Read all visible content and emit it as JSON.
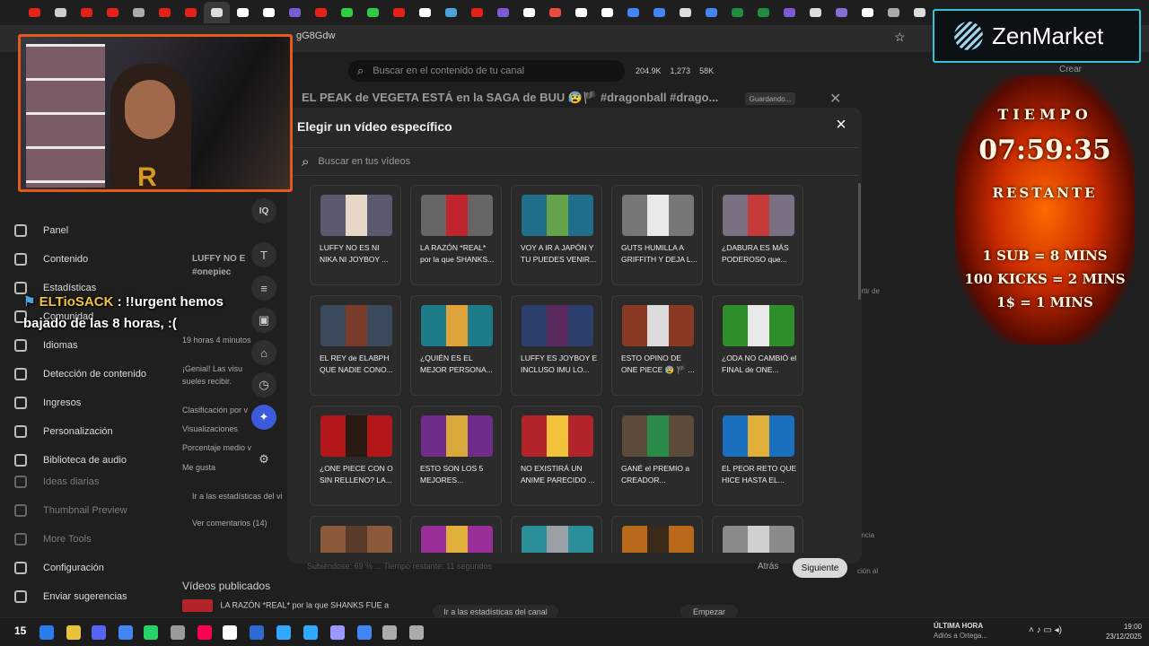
{
  "browser": {
    "url_fragment": "gG8Gdw",
    "tab_colors": [
      "#e62117",
      "#cfcfcf",
      "#e62117",
      "#e62117",
      "#aaa",
      "#e62117",
      "#e62117",
      "#ddd",
      "#fff",
      "#fff",
      "#7b5cd6",
      "#e62117",
      "#2ecc40",
      "#2ecc40",
      "#e62117",
      "#fff",
      "#4aa3df",
      "#e62117",
      "#7b5cd6",
      "#fff",
      "#e84c3d",
      "#fff",
      "#fff",
      "#4285f4",
      "#4285f4",
      "#ddd",
      "#4285f4",
      "#1e8e3e",
      "#1e8e3e",
      "#7b5cd6",
      "#ddd",
      "#8a6cd6",
      "#fff",
      "#aaa",
      "#ddd"
    ]
  },
  "studio": {
    "search_placeholder": "Buscar en el contenido de tu canal",
    "stats": {
      "a": "204.9K",
      "b": "1,273",
      "c": "58K"
    },
    "video_title": "EL PEAK de VEGETA ESTÁ en la SAGA de BUU 😰🏴 #dragonball #drago...",
    "saving": "Guardando...",
    "sidebar": [
      {
        "label": "Panel",
        "dim": false
      },
      {
        "label": "Contenido",
        "dim": false
      },
      {
        "label": "Estadísticas",
        "dim": false
      },
      {
        "label": "Comunidad",
        "dim": false
      },
      {
        "label": "Idiomas",
        "dim": false
      },
      {
        "label": "Detección de contenido",
        "dim": false
      },
      {
        "label": "Ingresos",
        "dim": false
      },
      {
        "label": "Personalización",
        "dim": false
      },
      {
        "label": "Biblioteca de audio",
        "dim": false
      },
      {
        "label": "Ideas diarias",
        "dim": true
      },
      {
        "label": "Thumbnail Preview",
        "dim": true
      },
      {
        "label": "More Tools",
        "dim": true
      },
      {
        "label": "Configuración",
        "dim": false
      },
      {
        "label": "Enviar sugerencias",
        "dim": false
      }
    ],
    "bg_left": {
      "time": "19 horas 4 minutos",
      "tip1": "¡Genial! Las visu",
      "tip2": "sueles recibir.",
      "clas": "Clasificación por v",
      "views": "Visualizaciones",
      "avg": "Porcentaje medio v",
      "likes": "Me gusta",
      "goto_stats": "Ir a las estadísticas del vi",
      "comments": "Ver comentarios (14)"
    },
    "bg_card": {
      "title": "LUFFY NO E",
      "tag": "#onepiec"
    },
    "published_title": "Vídeos publicados",
    "published_row": "LA RAZÓN *REAL* por la que SHANKS FUE a ...",
    "goto_channel_stats": "Ir a las estadísticas del canal",
    "start": "Empezar",
    "create": "Crear",
    "right_notes": {
      "a": "artir de",
      "b": "encia",
      "c": "ción al"
    }
  },
  "modal": {
    "title": "Elegir un vídeo específico",
    "search_placeholder": "Buscar en tus vídeos",
    "upload_status": "Subiéndose: 69 % ... Tiempo restante: 11 segundos",
    "back": "Atrás",
    "next": "Siguiente",
    "videos": [
      {
        "t1": "LUFFY NO ES NI",
        "t2": "NIKA NI JOYBOY ...",
        "color": "#5b5870",
        "accent": "#e7d7c6"
      },
      {
        "t1": "LA RAZÓN *REAL*",
        "t2": "por la que SHANKS...",
        "color": "#666",
        "accent": "#c0242c"
      },
      {
        "t1": "VOY A IR A JAPÓN Y",
        "t2": "TU PUEDES VENIR...",
        "color": "#1f6f8b",
        "accent": "#66a24a"
      },
      {
        "t1": "GUTS HUMILLA A",
        "t2": "GRIFFITH Y DEJA L...",
        "color": "#777",
        "accent": "#e9e9e9"
      },
      {
        "t1": "¿DABURA ES MÁS",
        "t2": "PODEROSO que...",
        "color": "#7b6f82",
        "accent": "#c73a3a"
      },
      {
        "t1": "EL REY de ELABPH",
        "t2": "QUE NADIE CONO...",
        "color": "#3a4a5c",
        "accent": "#7b3b2a"
      },
      {
        "t1": "¿QUIÉN ES EL",
        "t2": "MEJOR PERSONA...",
        "color": "#1e7b8a",
        "accent": "#e0a33b"
      },
      {
        "t1": "LUFFY ES JOYBOY E",
        "t2": "INCLUSO IMU LO...",
        "color": "#2c3e6c",
        "accent": "#5a2a5e"
      },
      {
        "t1": "ESTO OPINO DE",
        "t2": "ONE PIECE 😰 🏴 ...",
        "color": "#8a3a22",
        "accent": "#dcdcdc"
      },
      {
        "t1": "¿ODA NO CAMBIÓ el",
        "t2": "FINAL de ONE...",
        "color": "#2e8f2a",
        "accent": "#e8e8e8"
      },
      {
        "t1": "¿ONE PIECE CON O",
        "t2": "SIN RELLENO? LA...",
        "color": "#b3171a",
        "accent": "#2a1a14"
      },
      {
        "t1": "ESTO SON LOS 5",
        "t2": "MEJORES...",
        "color": "#6f2c8a",
        "accent": "#d9a83a"
      },
      {
        "t1": "NO EXISTIRÁ UN",
        "t2": "ANIME PARECIDO ...",
        "color": "#b3232a",
        "accent": "#f2c23d"
      },
      {
        "t1": "GANÉ el PREMIO a",
        "t2": "CREADOR...",
        "color": "#5c4a3a",
        "accent": "#2a8a4a"
      },
      {
        "t1": "EL PEOR RETO QUE",
        "t2": "HICE HASTA EL...",
        "color": "#1a6fbf",
        "accent": "#e0b03b"
      },
      {
        "t1": "",
        "t2": "",
        "color": "#8a5a3a",
        "accent": "#5a3a2a"
      },
      {
        "t1": "",
        "t2": "",
        "color": "#9a2f9a",
        "accent": "#e0b03b"
      },
      {
        "t1": "",
        "t2": "",
        "color": "#2b8f9a",
        "accent": "#9aa0a6"
      },
      {
        "t1": "",
        "t2": "",
        "color": "#b86a1a",
        "accent": "#3a2a1a"
      },
      {
        "t1": "",
        "t2": "",
        "color": "#8a8a8a",
        "accent": "#d0d0d0"
      }
    ]
  },
  "overlay": {
    "chat_user": "ELTioSACK",
    "chat_message": ": !!urgent hemos bajado de las 8 horas, :(",
    "zen_name": "ZenMarket",
    "timer_label": "TIEMPO",
    "timer_value": "07:59:35",
    "timer_sub": "RESTANTE",
    "rule1": "1 SUB = 8 MINS",
    "rule2": "100 KICKS = 2 MINS",
    "rule3": "1$ = 1 MINS"
  },
  "taskbar": {
    "news_title": "ÚLTIMA HORA",
    "news_sub": "Adiós a Ortega...",
    "time": "19:00",
    "date": "23/12/2025",
    "icons": [
      "#2b7de9",
      "#e7c23a",
      "#5865f2",
      "#4285f4",
      "#25d366",
      "#999",
      "#ff0050",
      "#fff",
      "#2d6bd2",
      "#31a8ff",
      "#31a8ff",
      "#9999ff",
      "#4285f4",
      "#aaa",
      "#aaa"
    ]
  }
}
